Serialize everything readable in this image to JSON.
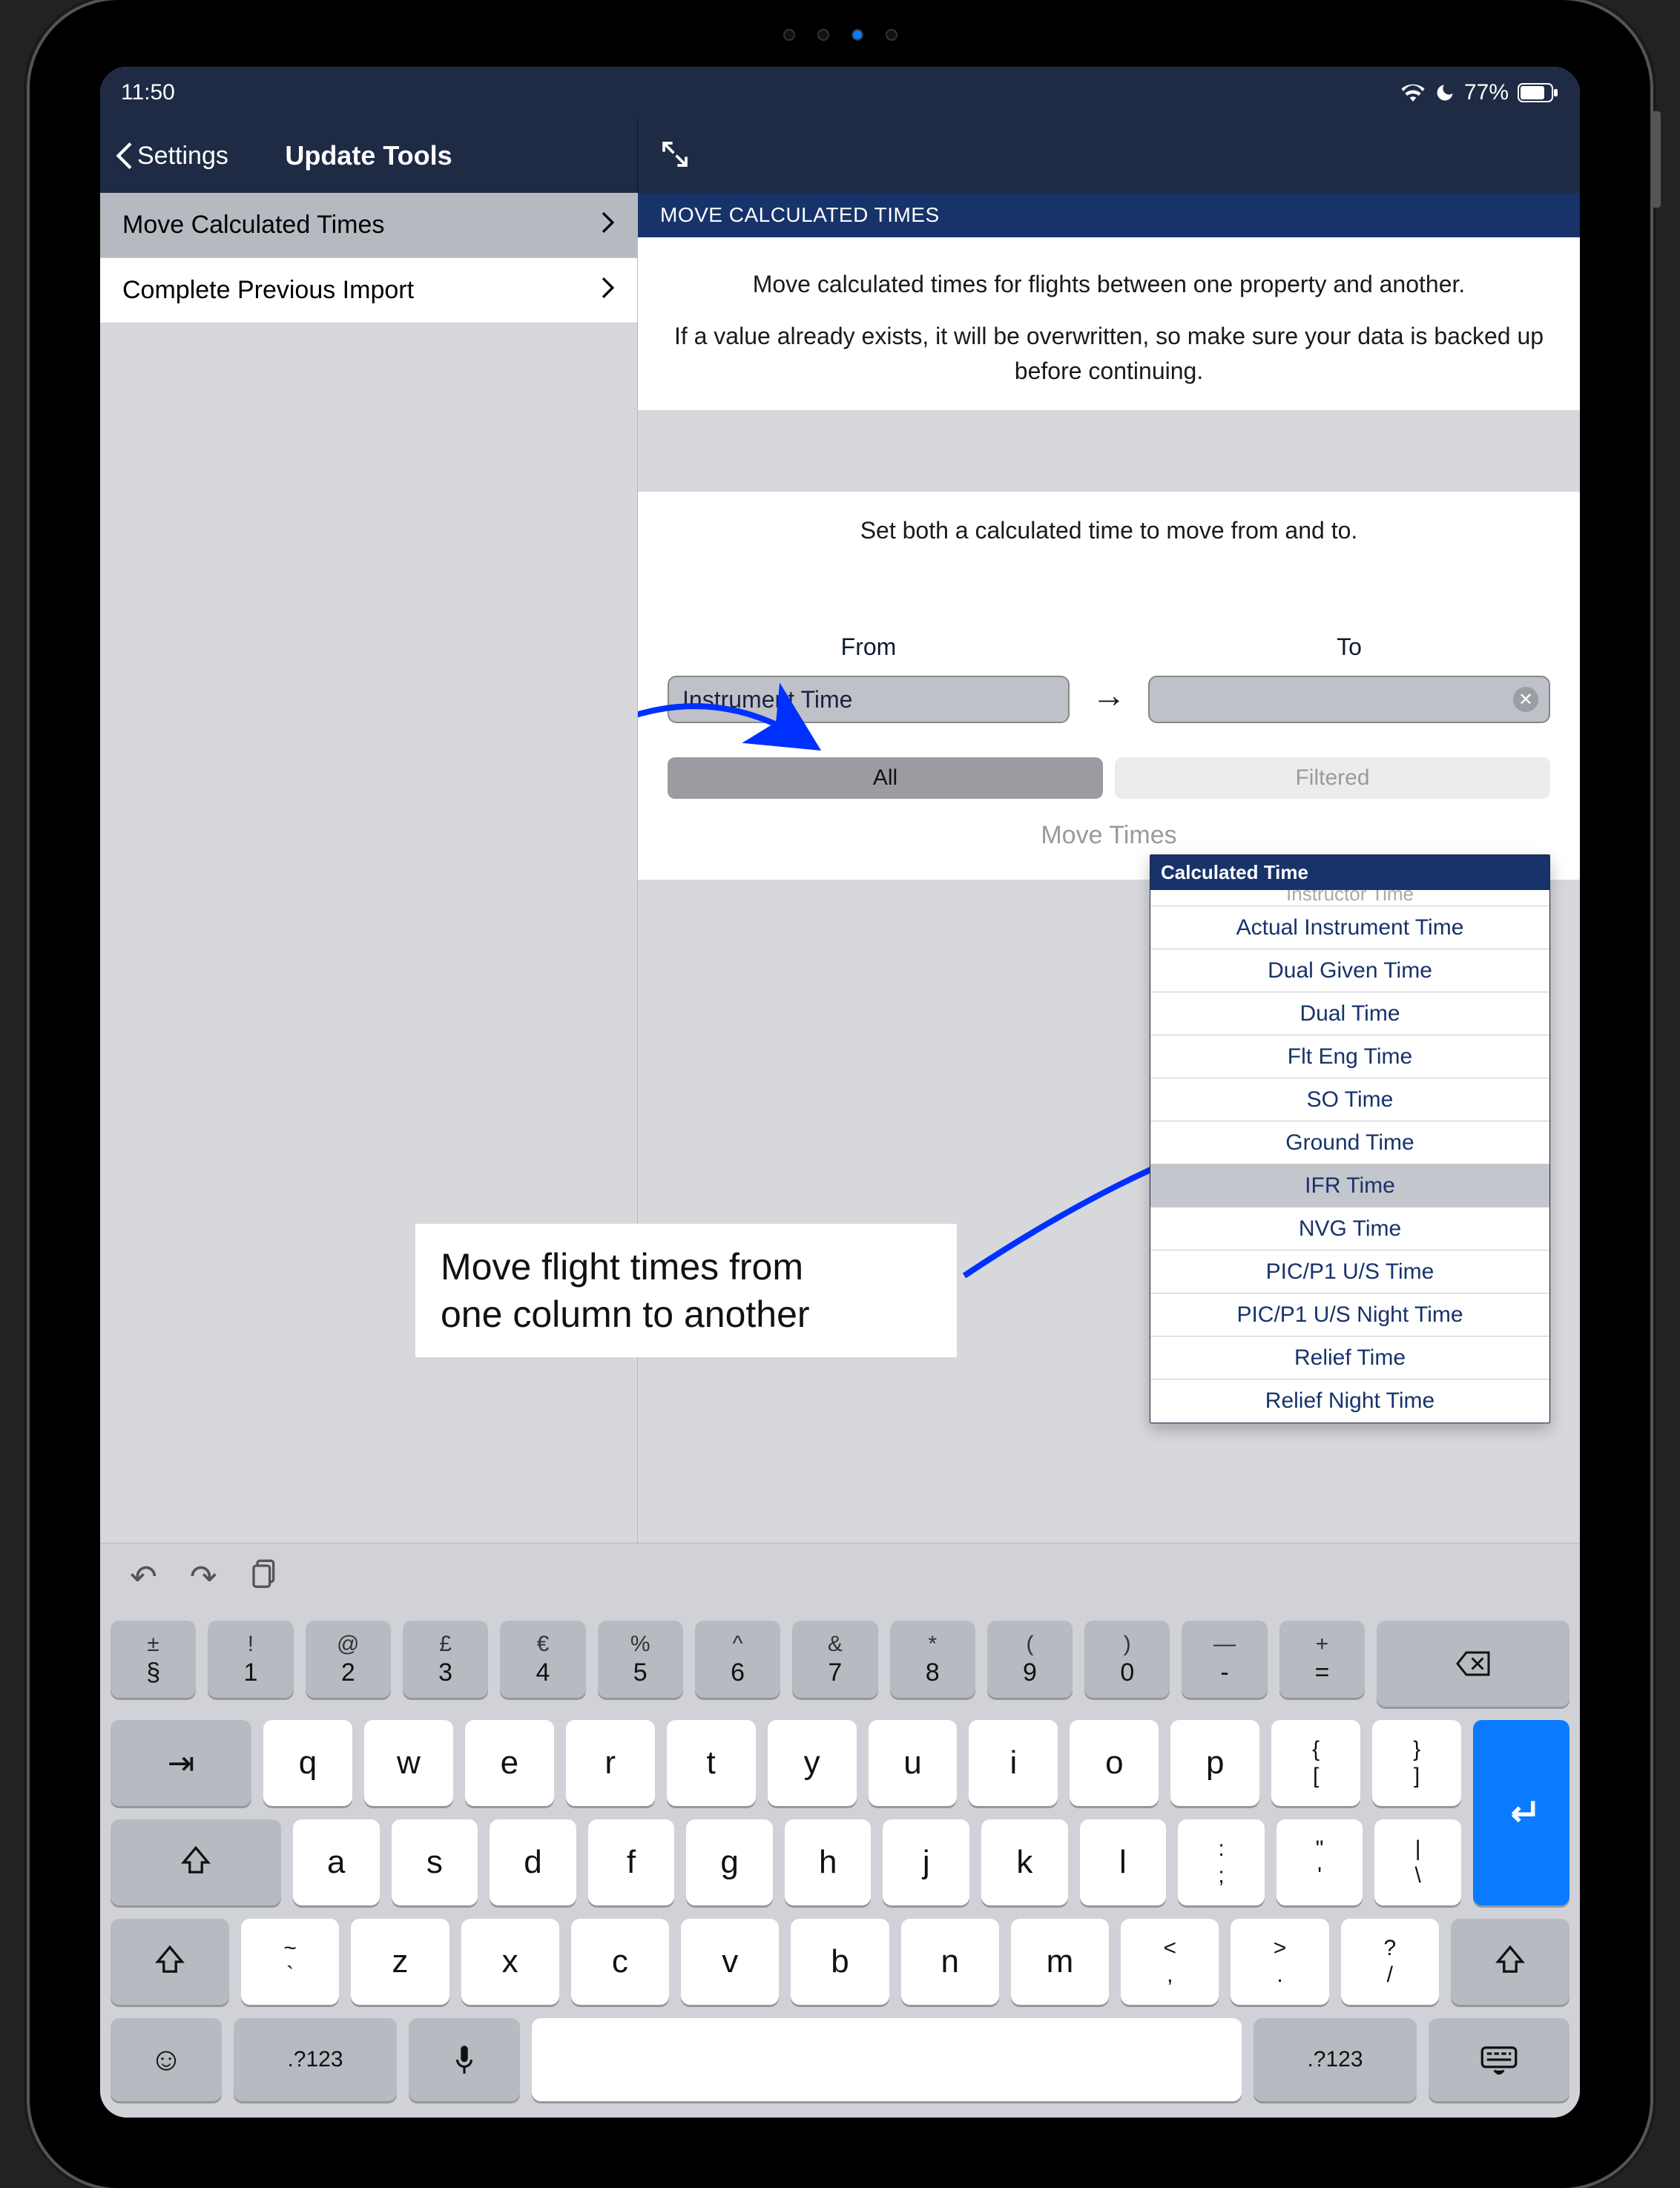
{
  "status": {
    "time": "11:50",
    "battery": "77%"
  },
  "nav": {
    "back": "Settings",
    "title": "Update Tools"
  },
  "sidebar": {
    "items": [
      {
        "label": "Move Calculated Times",
        "selected": true
      },
      {
        "label": "Complete Previous Import",
        "selected": false
      }
    ]
  },
  "detail": {
    "section_header": "MOVE CALCULATED TIMES",
    "desc1": "Move calculated times for flights between one property and another.",
    "desc2": "If a value already exists, it will be overwritten, so make sure your data is backed up before continuing.",
    "hint": "Set both a calculated time to move from and to.",
    "from_label": "From",
    "to_label": "To",
    "from_value": "Instrument Time",
    "to_value": "",
    "seg_all": "All",
    "seg_filtered": "Filtered",
    "move_btn": "Move Times"
  },
  "dropdown": {
    "header": "Calculated Time",
    "partial_top": "Instructor Time",
    "items": [
      "Actual Instrument Time",
      "Dual Given Time",
      "Dual Time",
      "Flt Eng Time",
      "SO Time",
      "Ground Time",
      "IFR Time",
      "NVG Time",
      "PIC/P1 U/S Time",
      "PIC/P1 U/S Night Time",
      "Relief Time",
      "Relief Night Time"
    ],
    "selected_index": 6
  },
  "annotation": {
    "line1": "Move flight times from",
    "line2": "one column to another"
  },
  "keyboard": {
    "row1": [
      {
        "t": "±",
        "b": "§"
      },
      {
        "t": "!",
        "b": "1"
      },
      {
        "t": "@",
        "b": "2"
      },
      {
        "t": "£",
        "b": "3"
      },
      {
        "t": "€",
        "b": "4"
      },
      {
        "t": "%",
        "b": "5"
      },
      {
        "t": "^",
        "b": "6"
      },
      {
        "t": "&",
        "b": "7"
      },
      {
        "t": "*",
        "b": "8"
      },
      {
        "t": "(",
        "b": "9"
      },
      {
        "t": ")",
        "b": "0"
      },
      {
        "t": "—",
        "b": "-"
      },
      {
        "t": "+",
        "b": "="
      }
    ],
    "row2": [
      "q",
      "w",
      "e",
      "r",
      "t",
      "y",
      "u",
      "i",
      "o",
      "p"
    ],
    "row2_brackets": [
      {
        "t": "{",
        "b": "["
      },
      {
        "t": "}",
        "b": "]"
      }
    ],
    "row3": [
      "a",
      "s",
      "d",
      "f",
      "g",
      "h",
      "j",
      "k",
      "l"
    ],
    "row3_tail": [
      {
        "t": ":",
        "b": ";"
      },
      {
        "t": "\"",
        "b": "'"
      },
      {
        "t": "|",
        "b": "\\"
      }
    ],
    "row4": [
      "z",
      "x",
      "c",
      "v",
      "b",
      "n",
      "m"
    ],
    "row4_lead": {
      "t": "~",
      "b": "`"
    },
    "row4_tail": [
      {
        "t": "<",
        "b": ","
      },
      {
        "t": ">",
        "b": "."
      },
      {
        "t": "?",
        "b": "/"
      }
    ],
    "numeric_label": ".?123"
  }
}
